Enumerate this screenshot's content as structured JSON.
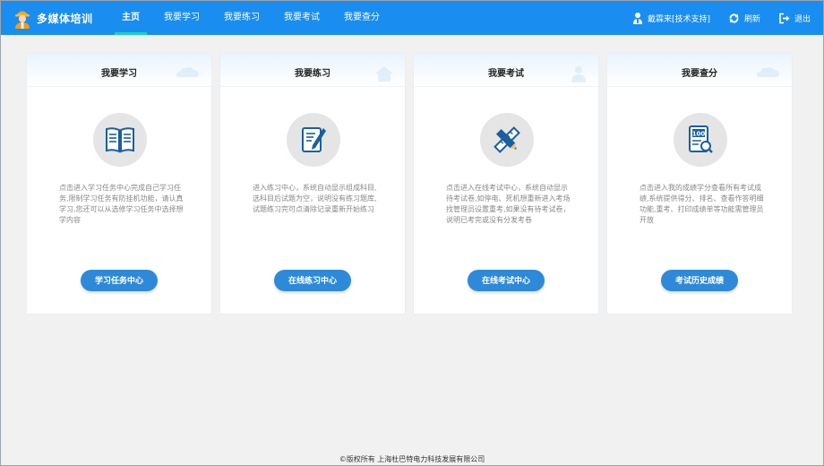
{
  "app": {
    "title": "多媒体培训"
  },
  "nav": [
    {
      "label": "主页"
    },
    {
      "label": "我要学习"
    },
    {
      "label": "我要练习"
    },
    {
      "label": "我要考试"
    },
    {
      "label": "我要查分"
    }
  ],
  "header_tools": {
    "user": "戴霖来[技术支持]",
    "refresh": "刷新",
    "logout": "退出"
  },
  "cards": [
    {
      "title": "我要学习",
      "icon": "book-icon",
      "desc": "点击进入学习任务中心完成自己学习任务,限制学习任务有防挂机功能，请认真学习,您还可以从选修学习任务中选择想学内容",
      "button": "学习任务中心"
    },
    {
      "title": "我要练习",
      "icon": "notebook-pen-icon",
      "desc": "进入练习中心，系统自动显示组成科目,选科目后试题为空，说明没有练习题库,试题练习完可点清除记录重新开始练习",
      "button": "在线练习中心"
    },
    {
      "title": "我要考试",
      "icon": "pencil-ruler-icon",
      "desc": "点击进入在线考试中心，系统自动显示待考试卷,如停电、死机想重新进入考场找管理员设置重考,如果没有待考试卷，说明已考完或没有分发考卷",
      "button": "在线考试中心"
    },
    {
      "title": "我要查分",
      "icon": "score-sheet-icon",
      "desc": "点击进入我的成绩学分查看所有考试成绩,系统提供得分、排名、查看作答明细功能,重考、打印成绩单等功能需管理员开放",
      "button": "考试历史成绩"
    }
  ],
  "footer": "©版权所有 上海杜巴特电力科技发展有限公司",
  "colors": {
    "topbar": "#1a8df0",
    "active_underline": "#19d3b9",
    "button": "#2e8ad8"
  }
}
